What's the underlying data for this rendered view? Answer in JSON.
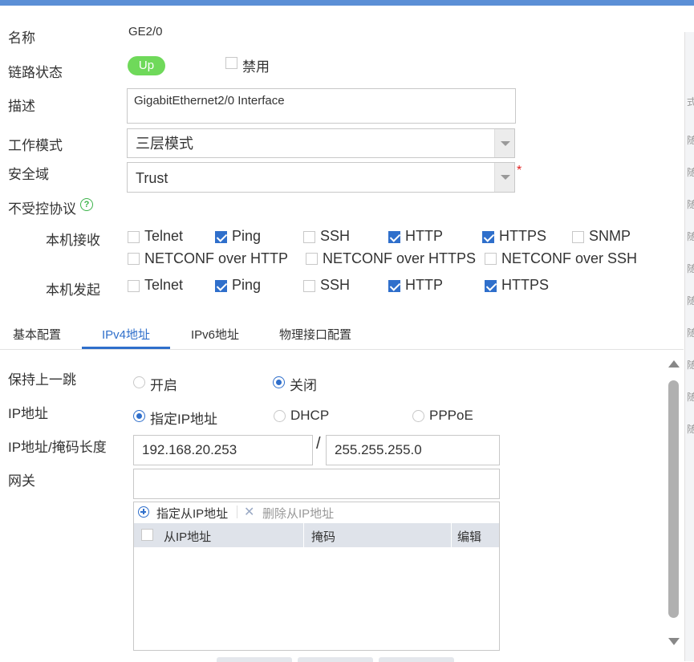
{
  "form": {
    "name_label": "名称",
    "name_value": "GE2/0",
    "link_status_label": "链路状态",
    "link_status_badge": "Up",
    "disable_label": "禁用",
    "disable_checked": false,
    "desc_label": "描述",
    "desc_value": "GigabitEthernet2/0 Interface",
    "work_mode_label": "工作模式",
    "work_mode_value": "三层模式",
    "security_zone_label": "安全域",
    "security_zone_value": "Trust",
    "required_mark": "*",
    "uncontrolled_label": "不受控协议",
    "help_glyph": "?"
  },
  "protocols": {
    "receive_label": "本机接收",
    "receive": [
      {
        "label": "Telnet",
        "checked": false
      },
      {
        "label": "Ping",
        "checked": true
      },
      {
        "label": "SSH",
        "checked": false
      },
      {
        "label": "HTTP",
        "checked": true
      },
      {
        "label": "HTTPS",
        "checked": true
      },
      {
        "label": "SNMP",
        "checked": false
      },
      {
        "label": "NETCONF over HTTP",
        "checked": false
      },
      {
        "label": "NETCONF over HTTPS",
        "checked": false
      },
      {
        "label": "NETCONF over SSH",
        "checked": false
      }
    ],
    "initiate_label": "本机发起",
    "initiate": [
      {
        "label": "Telnet",
        "checked": false
      },
      {
        "label": "Ping",
        "checked": true
      },
      {
        "label": "SSH",
        "checked": false
      },
      {
        "label": "HTTP",
        "checked": true
      },
      {
        "label": "HTTPS",
        "checked": true
      }
    ]
  },
  "tabs": [
    {
      "label": "基本配置",
      "active": false
    },
    {
      "label": "IPv4地址",
      "active": true
    },
    {
      "label": "IPv6地址",
      "active": false
    },
    {
      "label": "物理接口配置",
      "active": false
    }
  ],
  "ipv4": {
    "keep_hop_label": "保持上一跳",
    "keep_hop_on": "开启",
    "keep_hop_off": "关闭",
    "keep_hop_selected": "关闭",
    "ip_label": "IP地址",
    "ip_mode_static": "指定IP地址",
    "ip_mode_dhcp": "DHCP",
    "ip_mode_pppoe": "PPPoE",
    "ip_mode_selected": "指定IP地址",
    "ip_mask_label": "IP地址/掩码长度",
    "ip_value": "192.168.20.253",
    "slash": "/",
    "mask_value": "255.255.255.0",
    "gateway_label": "网关",
    "gateway_value": ""
  },
  "subip": {
    "add_label": "指定从IP地址",
    "delete_label": "删除从IP地址",
    "col_ip": "从IP地址",
    "col_mask": "掩码",
    "col_edit": "编辑"
  },
  "right_strip_glyphs": [
    "式",
    "随",
    "随",
    "随",
    "随",
    "随",
    "随",
    "随",
    "随",
    "随",
    "随"
  ],
  "colors": {
    "accent": "#2f6fcb",
    "up_badge": "#6fd95a",
    "required": "#e02020",
    "top_bar": "#5b8fd6"
  }
}
